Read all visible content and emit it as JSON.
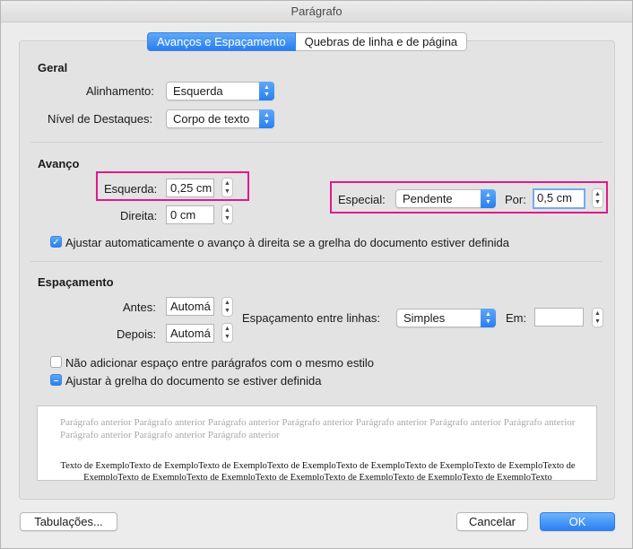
{
  "window": {
    "title": "Parágrafo"
  },
  "tabs": [
    {
      "label": "Avanços e Espaçamento"
    },
    {
      "label": "Quebras de linha e de página"
    }
  ],
  "geral": {
    "title": "Geral",
    "alinhamento_label": "Alinhamento:",
    "alinhamento_value": "Esquerda",
    "nivel_label": "Nível de Destaques:",
    "nivel_value": "Corpo de texto"
  },
  "avanco": {
    "title": "Avanço",
    "esquerda_label": "Esquerda:",
    "esquerda_value": "0,25 cm",
    "direita_label": "Direita:",
    "direita_value": "0 cm",
    "especial_label": "Especial:",
    "especial_value": "Pendente",
    "por_label": "Por:",
    "por_value": "0,5 cm",
    "ajustar_label": "Ajustar automaticamente o avanço à direita se a grelha do documento estiver definida"
  },
  "espacamento": {
    "title": "Espaçamento",
    "antes_label": "Antes:",
    "antes_value": "Automá",
    "depois_label": "Depois:",
    "depois_value": "Automá",
    "entre_linhas_label": "Espaçamento entre linhas:",
    "entre_linhas_value": "Simples",
    "em_label": "Em:",
    "em_value": "",
    "nao_adicionar_label": "Não adicionar espaço entre parágrafos com o mesmo estilo",
    "ajustar_grelha_label": "Ajustar à grelha do documento se estiver definida"
  },
  "preview": {
    "previous_text": "Parágrafo anterior Parágrafo anterior Parágrafo anterior Parágrafo anterior Parágrafo anterior Parágrafo anterior Parágrafo anterior Parágrafo anterior Parágrafo anterior Parágrafo anterior",
    "sample_text": "Texto de ExemploTexto de ExemploTexto de ExemploTexto de ExemploTexto de ExemploTexto de ExemploTexto de ExemploTexto de ExemploTexto de ExemploTexto de ExemploTexto de ExemploTexto de ExemploTexto de ExemploTexto de ExemploTexto"
  },
  "buttons": {
    "tabulacoes": "Tabulações...",
    "cancelar": "Cancelar",
    "ok": "OK"
  },
  "colors": {
    "accent": "#2a7ff0",
    "highlight": "#e0198b"
  }
}
